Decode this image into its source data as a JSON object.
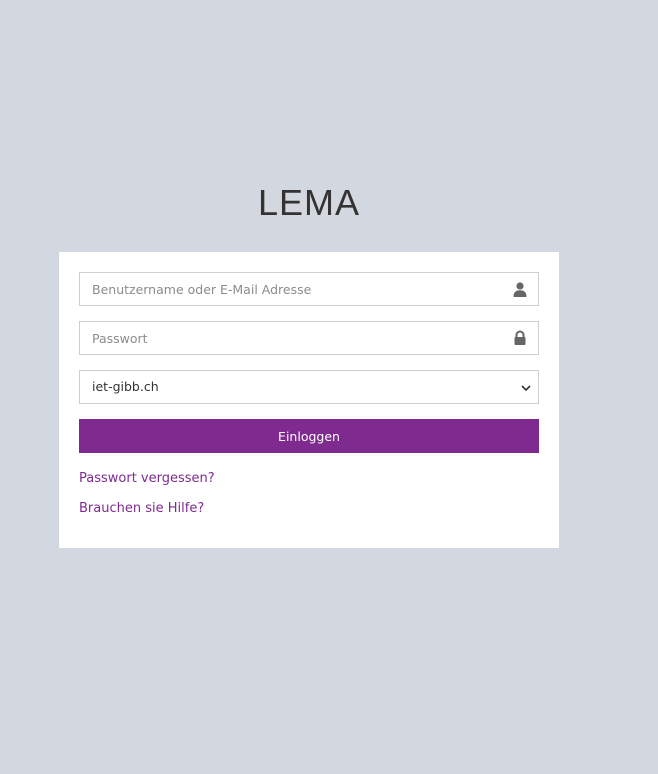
{
  "app": {
    "title": "LEMA"
  },
  "login_form": {
    "username": {
      "placeholder": "Benutzername oder E-Mail Adresse",
      "value": "",
      "icon": "user-icon"
    },
    "password": {
      "placeholder": "Passwort",
      "value": "",
      "icon": "lock-icon"
    },
    "domain_select": {
      "selected": "iet-gibb.ch",
      "icon": "chevron-down-icon"
    },
    "submit_label": "Einloggen",
    "forgot_password_label": "Passwort vergessen?",
    "help_label": "Brauchen sie Hilfe?"
  },
  "colors": {
    "background": "#d3d7df",
    "accent": "#7f2a8f",
    "card": "#ffffff"
  }
}
